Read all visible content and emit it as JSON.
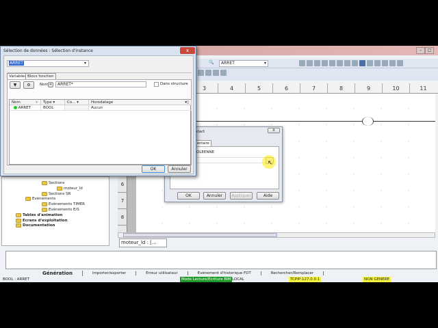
{
  "main": {
    "find_value": "ARRET",
    "ruler_columns": [
      "3",
      "4",
      "5",
      "6",
      "7",
      "8",
      "9",
      "10",
      "11"
    ],
    "row_numbers": [
      "6",
      "7",
      "8"
    ],
    "doc_tab": "moteur_ld : [..."
  },
  "tree": {
    "items": [
      {
        "label": "Sections",
        "bold": false
      },
      {
        "label": "moteur_ld",
        "bold": false
      },
      {
        "label": "Sections SR",
        "bold": false
      },
      {
        "label": "Evénements",
        "bold": false
      },
      {
        "label": "Evénements TIMER",
        "bold": false
      },
      {
        "label": "Evénements E/S",
        "bold": false
      },
      {
        "label": "Tables d'animation",
        "bold": true
      },
      {
        "label": "Ecrans d'exploitation",
        "bold": true
      },
      {
        "label": "Documentation",
        "bold": true
      }
    ]
  },
  "output_tabs": [
    "Génération",
    "Importer/exporter",
    "Erreur utilisateur",
    "Evénement d'historique FDT",
    "Rechercher/Remplacer"
  ],
  "status": {
    "left": "BOOL : ARRET",
    "mode": "Mode Lecture/Ecriture BIM",
    "local": "LOCAL",
    "address": "TCPIP:127.0.0.1",
    "gen": "NON GENERE",
    "mode_color": "#1f9a2a",
    "highlight_color": "#f5f542"
  },
  "dialog_instance": {
    "title": "Sélection de données : Sélection d'instance",
    "close": "x",
    "combo_value": "ARRET",
    "tabs": [
      "Variables",
      "Blocs fonction"
    ],
    "name_label": "Nom",
    "name_eq": "=",
    "name_filter": "ARRET*",
    "in_structure_label": "Dans structure",
    "columns": [
      "Nom",
      "Type",
      "Co...",
      "Horodatage"
    ],
    "rows": [
      {
        "name": "ARRET",
        "type": "BOOL",
        "comment": "",
        "timestamp": "Aucun"
      }
    ],
    "ok": "OK",
    "cancel": "Annuler"
  },
  "dialog_contact": {
    "title": "ntact",
    "close": "x",
    "tab": "entaire",
    "type_text": "OLEENNE",
    "browse": "...",
    "ok": "OK",
    "cancel": "Annuler",
    "apply": "Appliquer",
    "help": "Aide"
  }
}
